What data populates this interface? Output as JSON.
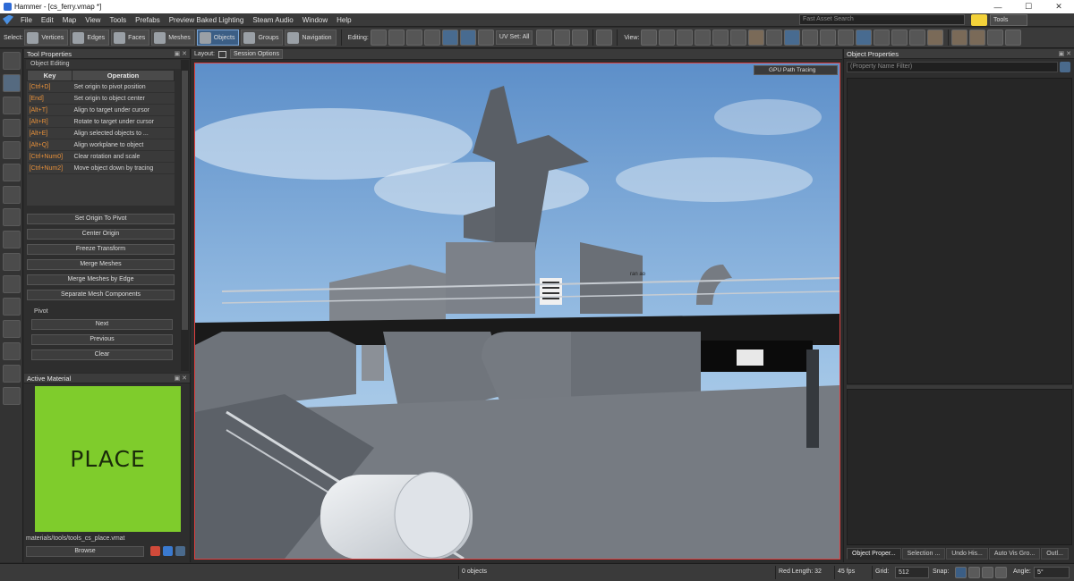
{
  "window": {
    "title": "Hammer - [cs_ferry.vmap *]",
    "min": "—",
    "max": "☐",
    "close": "✕"
  },
  "menu": {
    "items": [
      "File",
      "Edit",
      "Map",
      "View",
      "Tools",
      "Prefabs",
      "Preview Baked Lighting",
      "Steam Audio",
      "Window",
      "Help"
    ],
    "search_placeholder": "Fast Asset Search",
    "tools_label": "Tools"
  },
  "toolbar": {
    "select_label": "Select:",
    "select_modes": [
      "Vertices",
      "Edges",
      "Faces",
      "Meshes",
      "Objects",
      "Groups",
      "Navigation"
    ],
    "active_mode": "Objects",
    "editing_label": "Editing:",
    "uvset_label": "UV Set: All",
    "view_label": "View:"
  },
  "tool_properties": {
    "title": "Tool Properties",
    "section": "Object Editing",
    "columns": [
      "Key",
      "Operation"
    ],
    "rows": [
      {
        "key": "[Ctrl+D]",
        "op": "Set origin to pivot position"
      },
      {
        "key": "[End]",
        "op": "Set origin to object center"
      },
      {
        "key": "[Alt+T]",
        "op": "Align to target under cursor"
      },
      {
        "key": "[Alt+R]",
        "op": "Rotate to target under cursor"
      },
      {
        "key": "[Alt+E]",
        "op": "Align selected objects to ..."
      },
      {
        "key": "[Alt+Q]",
        "op": "Align workplane to object"
      },
      {
        "key": "[Ctrl+Num0]",
        "op": "Clear rotation and scale"
      },
      {
        "key": "[Ctrl+Num2]",
        "op": "Move object down by tracing"
      }
    ],
    "buttons": [
      "Set Origin To Pivot",
      "Center Origin",
      "Freeze Transform",
      "Merge Meshes",
      "Merge Meshes by Edge",
      "Separate Mesh Components"
    ],
    "pivot_label": "Pivot",
    "pivot_buttons": [
      "Next",
      "Previous",
      "Clear"
    ]
  },
  "active_material": {
    "title": "Active Material",
    "swatch_text": "PLACE",
    "swatch_color": "#7fcc2c",
    "path": "materials/tools/tools_cs_place.vmat",
    "browse": "Browse"
  },
  "viewport": {
    "layout_label": "Layout:",
    "session_options": "Session Options",
    "renderer": "GPU Path Tracing",
    "border_color": "#e04040",
    "sign_text": "ran ao"
  },
  "object_properties": {
    "title": "Object Properties",
    "filter_placeholder": "(Property Name Filter)",
    "tabs": [
      "Object Proper...",
      "Selection ...",
      "Undo His...",
      "Auto Vis Gro...",
      "Outl..."
    ]
  },
  "status": {
    "objects": "0 objects",
    "red_length": "Red Length: 32",
    "fps": "45 fps",
    "grid_label": "Grid:",
    "grid_value": "512",
    "snap_label": "Snap:",
    "angle_label": "Angle:",
    "angle_value": "5°"
  }
}
